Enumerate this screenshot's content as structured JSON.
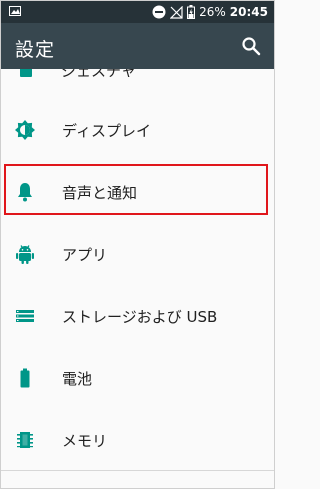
{
  "status_bar": {
    "battery_percent": "26%",
    "time": "20:45"
  },
  "app_bar": {
    "title": "設定"
  },
  "list": {
    "partial_item_label": "ジェスチャ",
    "items": [
      {
        "label": "ディスプレイ",
        "icon": "brightness-icon"
      },
      {
        "label": "音声と通知",
        "icon": "bell-icon"
      },
      {
        "label": "アプリ",
        "icon": "android-icon"
      },
      {
        "label": "ストレージおよび USB",
        "icon": "storage-icon"
      },
      {
        "label": "電池",
        "icon": "battery-icon"
      },
      {
        "label": "メモリ",
        "icon": "memory-icon"
      }
    ]
  },
  "colors": {
    "status_bar": "#263238",
    "app_bar": "#37474f",
    "accent_icon": "#009688",
    "highlight": "#e0161b"
  }
}
